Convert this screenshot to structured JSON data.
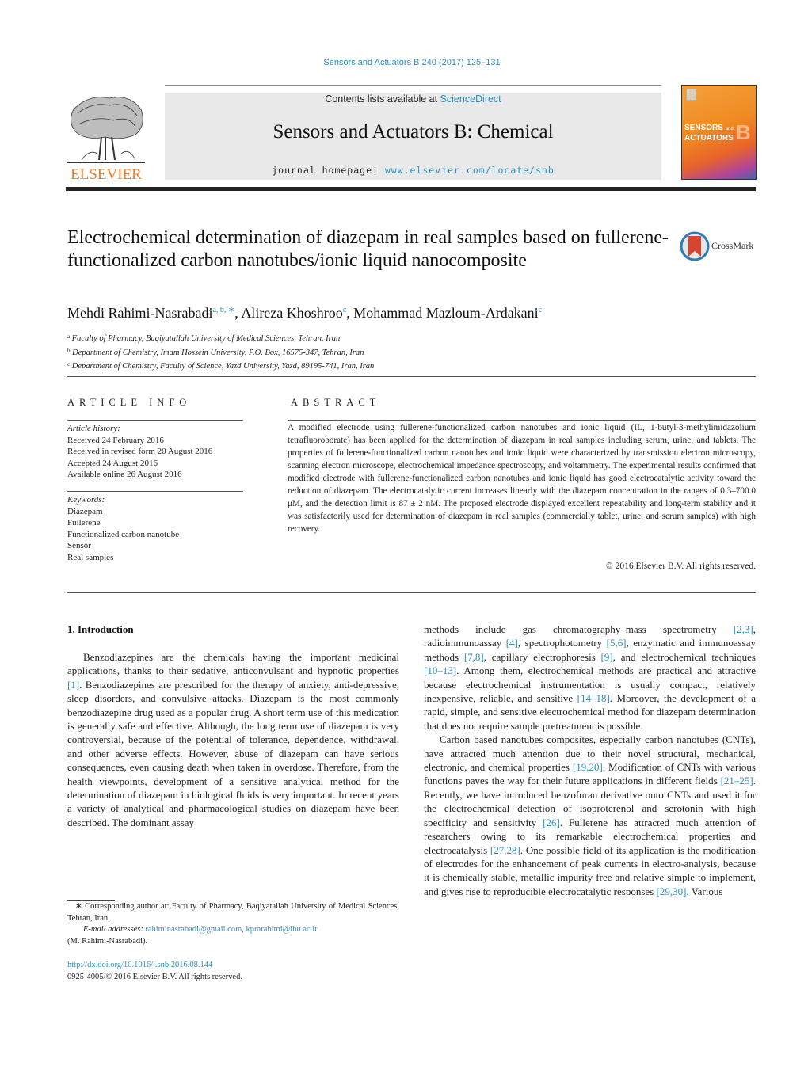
{
  "running_head": "Sensors and Actuators B 240 (2017) 125–131",
  "publisher": {
    "logo_text": "ELSEVIER",
    "logo_color": "#f07b20"
  },
  "banner": {
    "contents_prefix": "Contents lists available at ",
    "contents_link": "ScienceDirect",
    "journal_title": "Sensors and Actuators B: Chemical",
    "homepage_prefix": "journal homepage: ",
    "homepage_link": "www.elsevier.com/locate/snb"
  },
  "cover": {
    "line1": "SENSORS",
    "line1_small": "and",
    "line2": "ACTUATORS",
    "letter": "B"
  },
  "crossmark": {
    "label": "CrossMark"
  },
  "article": {
    "title": "Electrochemical determination of diazepam in real samples based on fullerene-functionalized carbon nanotubes/ionic liquid nanocomposite",
    "authors": [
      {
        "name": "Mehdi Rahimi-Nasrabadi",
        "marks": "a, b, ∗",
        "sep": ", "
      },
      {
        "name": "Alireza Khoshroo",
        "marks": "c",
        "sep": ", "
      },
      {
        "name": "Mohammad Mazloum-Ardakani",
        "marks": "c",
        "sep": ""
      }
    ],
    "affiliations": [
      {
        "mark": "a",
        "text": "Faculty of Pharmacy, Baqiyatallah University of Medical Sciences, Tehran, Iran"
      },
      {
        "mark": "b",
        "text": "Department of Chemistry, Imam Hossein University, P.O. Box, 16575-347, Tehran, Iran"
      },
      {
        "mark": "c",
        "text": "Department of Chemistry, Faculty of Science, Yazd University, Yazd, 89195-741, Iran, Iran"
      }
    ]
  },
  "article_info": {
    "heading": "ARTICLE INFO",
    "history_label": "Article history:",
    "history": [
      "Received 24 February 2016",
      "Received in revised form 20 August 2016",
      "Accepted 24 August 2016",
      "Available online 26 August 2016"
    ],
    "keywords_label": "Keywords:",
    "keywords": [
      "Diazepam",
      "Fullerene",
      "Functionalized carbon nanotube",
      "Sensor",
      "Real samples"
    ]
  },
  "abstract": {
    "heading": "ABSTRACT",
    "text": "A modified electrode using fullerene-functionalized carbon nanotubes and ionic liquid (IL, 1-butyl-3-methylimidazolium tetrafluoroborate) has been applied for the determination of diazepam in real samples including serum, urine, and tablets. The properties of fullerene-functionalized carbon nanotubes and ionic liquid were characterized by transmission electron microscopy, scanning electron microscope, electrochemical impedance spectroscopy, and voltammetry. The experimental results confirmed that modified electrode with fullerene-functionalized carbon nanotubes and ionic liquid has good electrocatalytic activity toward the reduction of diazepam. The electrocatalytic current increases linearly with the diazepam concentration in the ranges of 0.3–700.0 μM, and the detection limit is 87 ± 2 nM. The proposed electrode displayed excellent repeatability and long-term stability and it was satisfactorily used for determination of diazepam in real samples (commercially tablet, urine, and serum samples) with high recovery.",
    "copyright": "© 2016 Elsevier B.V. All rights reserved."
  },
  "introduction": {
    "heading": "1.  Introduction",
    "left_para": [
      {
        "t": "Benzodiazepines are the chemicals having the important medicinal applications, thanks to their sedative, anticonvulsant and hypnotic properties "
      },
      {
        "ref": "[1]"
      },
      {
        "t": ". Benzodiazepines are prescribed for the therapy of anxiety, anti-depressive, sleep disorders, and convulsive attacks. Diazepam is the most commonly benzodiazepine drug used as a popular drug. A short term use of this medication is generally safe and effective. Although, the long term use of diazepam is very controversial, because of the potential of tolerance, dependence, withdrawal, and other adverse effects. However, abuse of diazepam can have serious consequences, even causing death when taken in overdose. Therefore, from the health viewpoints, development of a sensitive analytical method for the determination of diazepam in biological fluids is very important. In recent years a variety of analytical and pharmacological studies on diazepam have been described. The dominant assay"
      }
    ],
    "right_para1": [
      {
        "t": "methods include gas chromatography–mass spectrometry "
      },
      {
        "ref": "[2,3]"
      },
      {
        "t": ", radioimmunoassay "
      },
      {
        "ref": "[4]"
      },
      {
        "t": ", spectrophotometry "
      },
      {
        "ref": "[5,6]"
      },
      {
        "t": ", enzymatic and immunoassay methods "
      },
      {
        "ref": "[7,8]"
      },
      {
        "t": ", capillary electrophoresis "
      },
      {
        "ref": "[9]"
      },
      {
        "t": ", and electrochemical techniques "
      },
      {
        "ref": "[10–13]"
      },
      {
        "t": ". Among them, electrochemical methods are practical and attractive because electrochemical instrumentation is usually compact, relatively inexpensive, reliable, and sensitive "
      },
      {
        "ref": "[14–18]"
      },
      {
        "t": ". Moreover, the development of a rapid, simple, and sensitive electrochemical method for diazepam determination that does not require sample pretreatment is possible."
      }
    ],
    "right_para2": [
      {
        "t": "Carbon based nanotubes composites, especially carbon nanotubes (CNTs), have attracted much attention due to their novel structural, mechanical, electronic, and chemical properties "
      },
      {
        "ref": "[19,20]"
      },
      {
        "t": ". Modification of CNTs with various functions paves the way for their future applications in different fields "
      },
      {
        "ref": "[21–25]"
      },
      {
        "t": ". Recently, we have introduced benzofuran derivative onto CNTs and used it for the electrochemical detection of isoproterenol and serotonin with high specificity and sensitivity "
      },
      {
        "ref": "[26]"
      },
      {
        "t": ". Fullerene has attracted much attention of researchers owing to its remarkable electrochemical properties and electrocatalysis "
      },
      {
        "ref": "[27,28]"
      },
      {
        "t": ". One possible field of its application is the modification of electrodes for the enhancement of peak currents in electro-analysis, because it is chemically stable, metallic impurity free and relative simple to implement, and gives rise to reproducible electrocatalytic responses "
      },
      {
        "ref": "[29,30]"
      },
      {
        "t": ". Various"
      }
    ]
  },
  "footnote": {
    "corresponding": "∗ Corresponding author at: Faculty of Pharmacy, Baqiyatallah University of Medical Sciences, Tehran, Iran.",
    "email_label": "E-mail addresses:",
    "emails": [
      "rahiminasrabadi@gmail.com",
      "kpmrahimi@ihu.ac.ir"
    ],
    "email_owner": "(M. Rahimi-Nasrabadi).",
    "doi": "http://dx.doi.org/10.1016/j.snb.2016.08.144",
    "issn": "0925-4005/© 2016 Elsevier B.V. All rights reserved."
  },
  "colors": {
    "link": "#2a8fbd",
    "banner_bg": "#e9e9ea",
    "crossmark_red": "#d9442e",
    "crossmark_ring": "#2a7cb6"
  }
}
